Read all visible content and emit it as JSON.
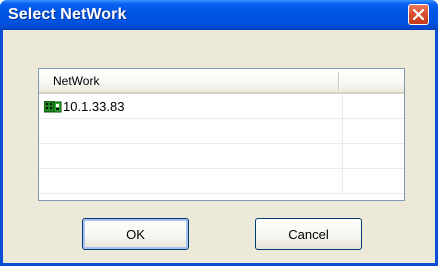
{
  "window": {
    "title": "Select NetWork"
  },
  "list": {
    "columns": [
      "NetWork",
      ""
    ],
    "rows": [
      {
        "icon": "network-card-icon",
        "text": "10.1.33.83"
      },
      {
        "icon": "",
        "text": ""
      },
      {
        "icon": "",
        "text": ""
      },
      {
        "icon": "",
        "text": ""
      }
    ]
  },
  "buttons": {
    "ok": "OK",
    "cancel": "Cancel"
  },
  "colors": {
    "titlebar": "#0054e3",
    "dialog_background": "#ece9d8",
    "close_button": "#d8502f"
  }
}
